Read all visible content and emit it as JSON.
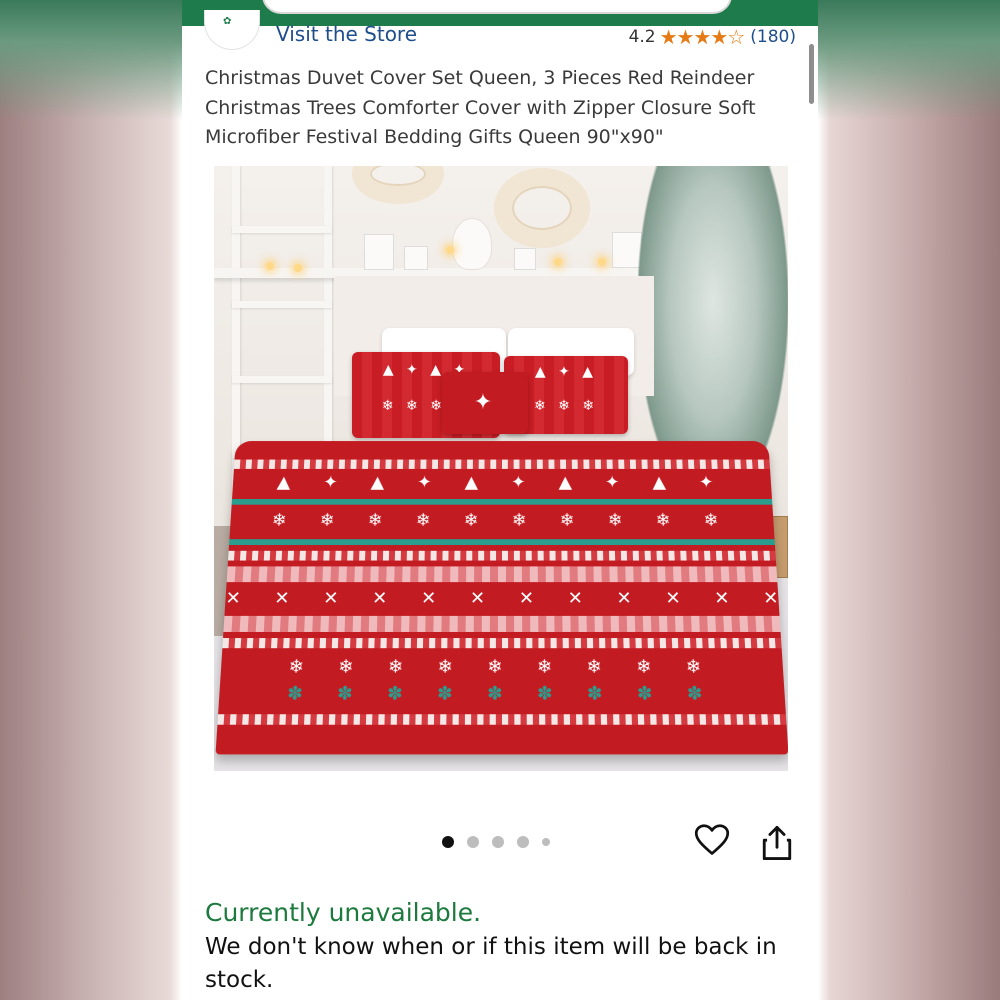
{
  "store": {
    "link_label": "Visit the Store"
  },
  "rating": {
    "value": "4.2",
    "stars": "★★★★☆",
    "count": "(180)"
  },
  "product": {
    "title": "Christmas Duvet Cover Set Queen, 3 Pieces Red Reindeer Christmas Trees Comforter Cover with Zipper Closure Soft Microfiber Festival Bedding Gifts Queen 90\"x90\""
  },
  "gallery": {
    "image_count": 5,
    "active_index": 0
  },
  "actions": {
    "favorite_icon": "heart-icon",
    "share_icon": "share-icon"
  },
  "availability": {
    "status": "Currently unavailable.",
    "message": "We don't know when or if this item will be back in stock."
  },
  "colors": {
    "brand_green": "#1e7b4b",
    "link_blue": "#1f4e8c",
    "star_orange": "#e67a14",
    "unavailable_green": "#1d7a3e"
  }
}
